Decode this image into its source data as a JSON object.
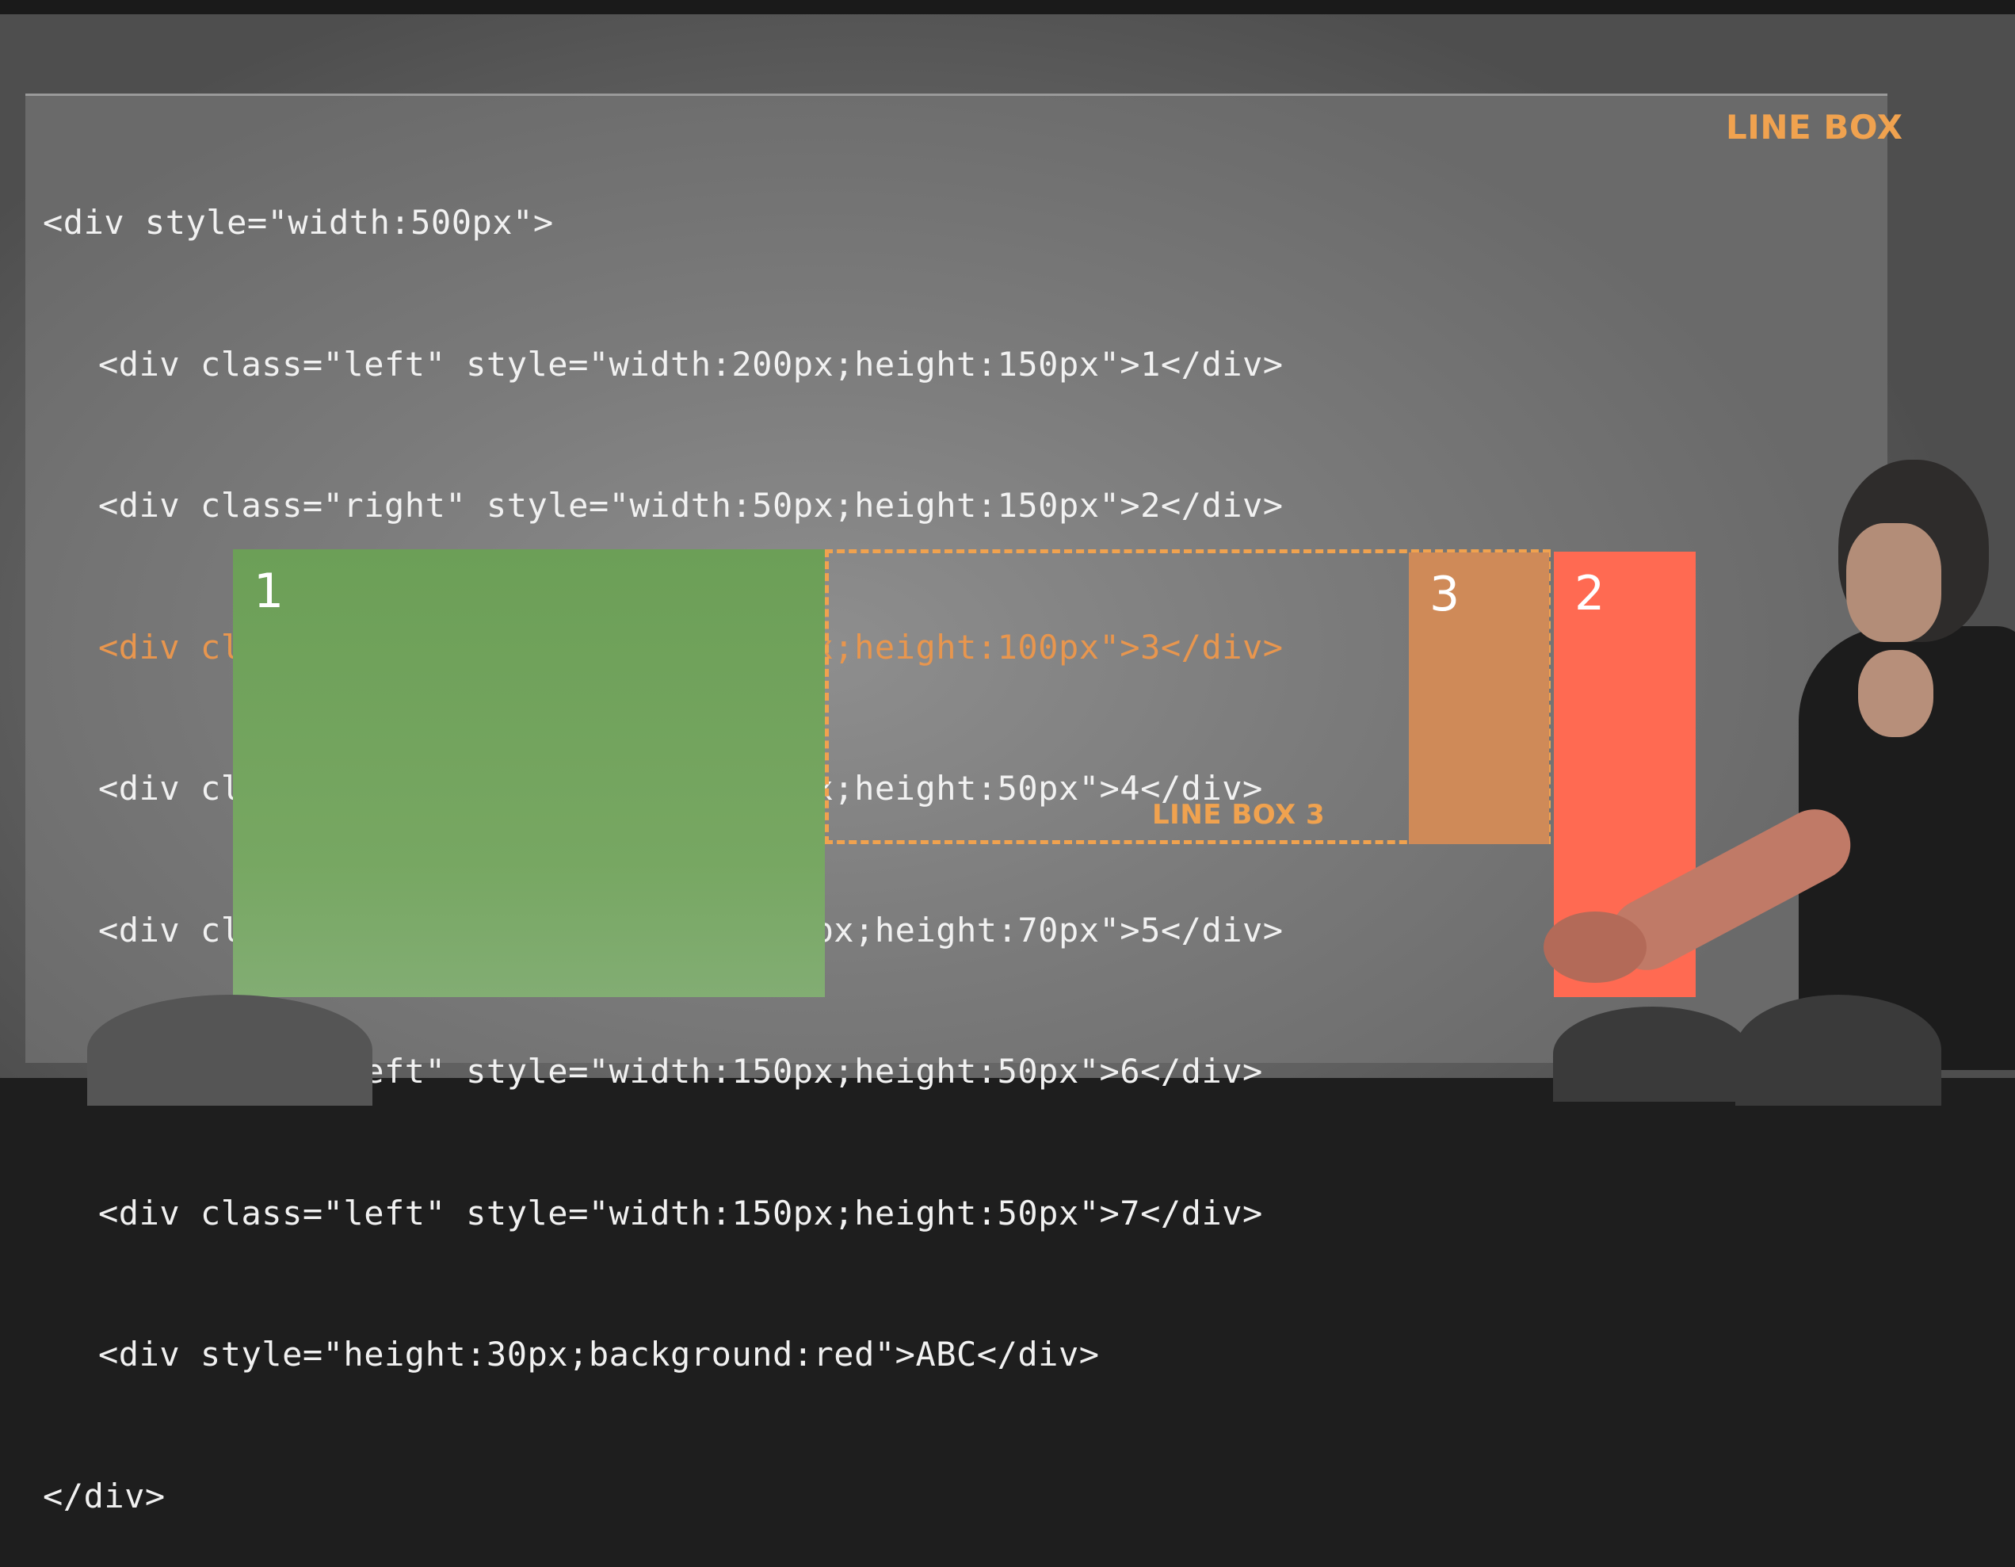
{
  "slide": {
    "title_label": "LINE BOX",
    "code_lines": [
      "<div style=\"width:500px\">",
      "<div class=\"left\" style=\"width:200px;height:150px\">1</div>",
      "<div class=\"right\" style=\"width:50px;height:150px\">2</div>",
      "<div class=\"right\" style=\"width:50px;height:100px\">3</div>",
      "<div class=\"left\" style=\"width:150px;height:50px\">4</div>",
      "<div class=\"right\" style=\"width:150px;height:70px\">5</div>",
      "<div class=\"left\" style=\"width:150px;height:50px\">6</div>",
      "<div class=\"left\" style=\"width:150px;height:50px\">7</div>",
      "<div style=\"height:30px;background:red\">ABC</div>",
      "</div>"
    ],
    "boxes": {
      "box_1": "1",
      "box_2": "2",
      "box_3": "3"
    },
    "linebox_label": "LINE BOX 3"
  },
  "colors": {
    "accent_orange": "#f0a24f",
    "highlight_code": "#e8964e",
    "box_green": "#6c9f57",
    "box_red": "#ff6a52",
    "box_tan": "#cf8a58"
  }
}
